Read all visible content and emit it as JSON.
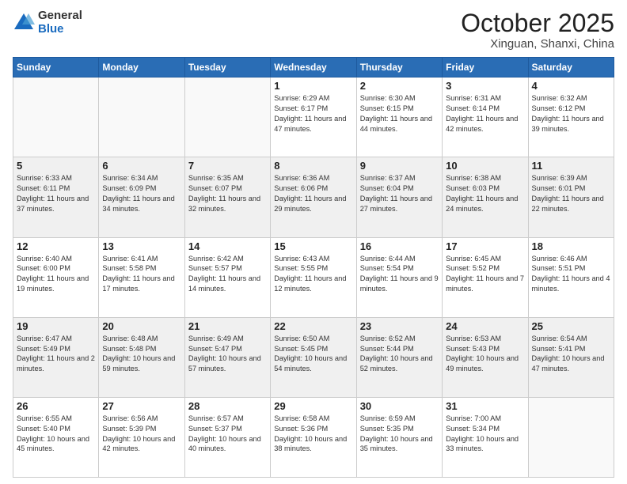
{
  "logo": {
    "general": "General",
    "blue": "Blue"
  },
  "header": {
    "month": "October 2025",
    "location": "Xinguan, Shanxi, China"
  },
  "days_of_week": [
    "Sunday",
    "Monday",
    "Tuesday",
    "Wednesday",
    "Thursday",
    "Friday",
    "Saturday"
  ],
  "weeks": [
    [
      {
        "day": "",
        "text": ""
      },
      {
        "day": "",
        "text": ""
      },
      {
        "day": "",
        "text": ""
      },
      {
        "day": "1",
        "text": "Sunrise: 6:29 AM\nSunset: 6:17 PM\nDaylight: 11 hours and 47 minutes."
      },
      {
        "day": "2",
        "text": "Sunrise: 6:30 AM\nSunset: 6:15 PM\nDaylight: 11 hours and 44 minutes."
      },
      {
        "day": "3",
        "text": "Sunrise: 6:31 AM\nSunset: 6:14 PM\nDaylight: 11 hours and 42 minutes."
      },
      {
        "day": "4",
        "text": "Sunrise: 6:32 AM\nSunset: 6:12 PM\nDaylight: 11 hours and 39 minutes."
      }
    ],
    [
      {
        "day": "5",
        "text": "Sunrise: 6:33 AM\nSunset: 6:11 PM\nDaylight: 11 hours and 37 minutes."
      },
      {
        "day": "6",
        "text": "Sunrise: 6:34 AM\nSunset: 6:09 PM\nDaylight: 11 hours and 34 minutes."
      },
      {
        "day": "7",
        "text": "Sunrise: 6:35 AM\nSunset: 6:07 PM\nDaylight: 11 hours and 32 minutes."
      },
      {
        "day": "8",
        "text": "Sunrise: 6:36 AM\nSunset: 6:06 PM\nDaylight: 11 hours and 29 minutes."
      },
      {
        "day": "9",
        "text": "Sunrise: 6:37 AM\nSunset: 6:04 PM\nDaylight: 11 hours and 27 minutes."
      },
      {
        "day": "10",
        "text": "Sunrise: 6:38 AM\nSunset: 6:03 PM\nDaylight: 11 hours and 24 minutes."
      },
      {
        "day": "11",
        "text": "Sunrise: 6:39 AM\nSunset: 6:01 PM\nDaylight: 11 hours and 22 minutes."
      }
    ],
    [
      {
        "day": "12",
        "text": "Sunrise: 6:40 AM\nSunset: 6:00 PM\nDaylight: 11 hours and 19 minutes."
      },
      {
        "day": "13",
        "text": "Sunrise: 6:41 AM\nSunset: 5:58 PM\nDaylight: 11 hours and 17 minutes."
      },
      {
        "day": "14",
        "text": "Sunrise: 6:42 AM\nSunset: 5:57 PM\nDaylight: 11 hours and 14 minutes."
      },
      {
        "day": "15",
        "text": "Sunrise: 6:43 AM\nSunset: 5:55 PM\nDaylight: 11 hours and 12 minutes."
      },
      {
        "day": "16",
        "text": "Sunrise: 6:44 AM\nSunset: 5:54 PM\nDaylight: 11 hours and 9 minutes."
      },
      {
        "day": "17",
        "text": "Sunrise: 6:45 AM\nSunset: 5:52 PM\nDaylight: 11 hours and 7 minutes."
      },
      {
        "day": "18",
        "text": "Sunrise: 6:46 AM\nSunset: 5:51 PM\nDaylight: 11 hours and 4 minutes."
      }
    ],
    [
      {
        "day": "19",
        "text": "Sunrise: 6:47 AM\nSunset: 5:49 PM\nDaylight: 11 hours and 2 minutes."
      },
      {
        "day": "20",
        "text": "Sunrise: 6:48 AM\nSunset: 5:48 PM\nDaylight: 10 hours and 59 minutes."
      },
      {
        "day": "21",
        "text": "Sunrise: 6:49 AM\nSunset: 5:47 PM\nDaylight: 10 hours and 57 minutes."
      },
      {
        "day": "22",
        "text": "Sunrise: 6:50 AM\nSunset: 5:45 PM\nDaylight: 10 hours and 54 minutes."
      },
      {
        "day": "23",
        "text": "Sunrise: 6:52 AM\nSunset: 5:44 PM\nDaylight: 10 hours and 52 minutes."
      },
      {
        "day": "24",
        "text": "Sunrise: 6:53 AM\nSunset: 5:43 PM\nDaylight: 10 hours and 49 minutes."
      },
      {
        "day": "25",
        "text": "Sunrise: 6:54 AM\nSunset: 5:41 PM\nDaylight: 10 hours and 47 minutes."
      }
    ],
    [
      {
        "day": "26",
        "text": "Sunrise: 6:55 AM\nSunset: 5:40 PM\nDaylight: 10 hours and 45 minutes."
      },
      {
        "day": "27",
        "text": "Sunrise: 6:56 AM\nSunset: 5:39 PM\nDaylight: 10 hours and 42 minutes."
      },
      {
        "day": "28",
        "text": "Sunrise: 6:57 AM\nSunset: 5:37 PM\nDaylight: 10 hours and 40 minutes."
      },
      {
        "day": "29",
        "text": "Sunrise: 6:58 AM\nSunset: 5:36 PM\nDaylight: 10 hours and 38 minutes."
      },
      {
        "day": "30",
        "text": "Sunrise: 6:59 AM\nSunset: 5:35 PM\nDaylight: 10 hours and 35 minutes."
      },
      {
        "day": "31",
        "text": "Sunrise: 7:00 AM\nSunset: 5:34 PM\nDaylight: 10 hours and 33 minutes."
      },
      {
        "day": "",
        "text": ""
      }
    ]
  ]
}
